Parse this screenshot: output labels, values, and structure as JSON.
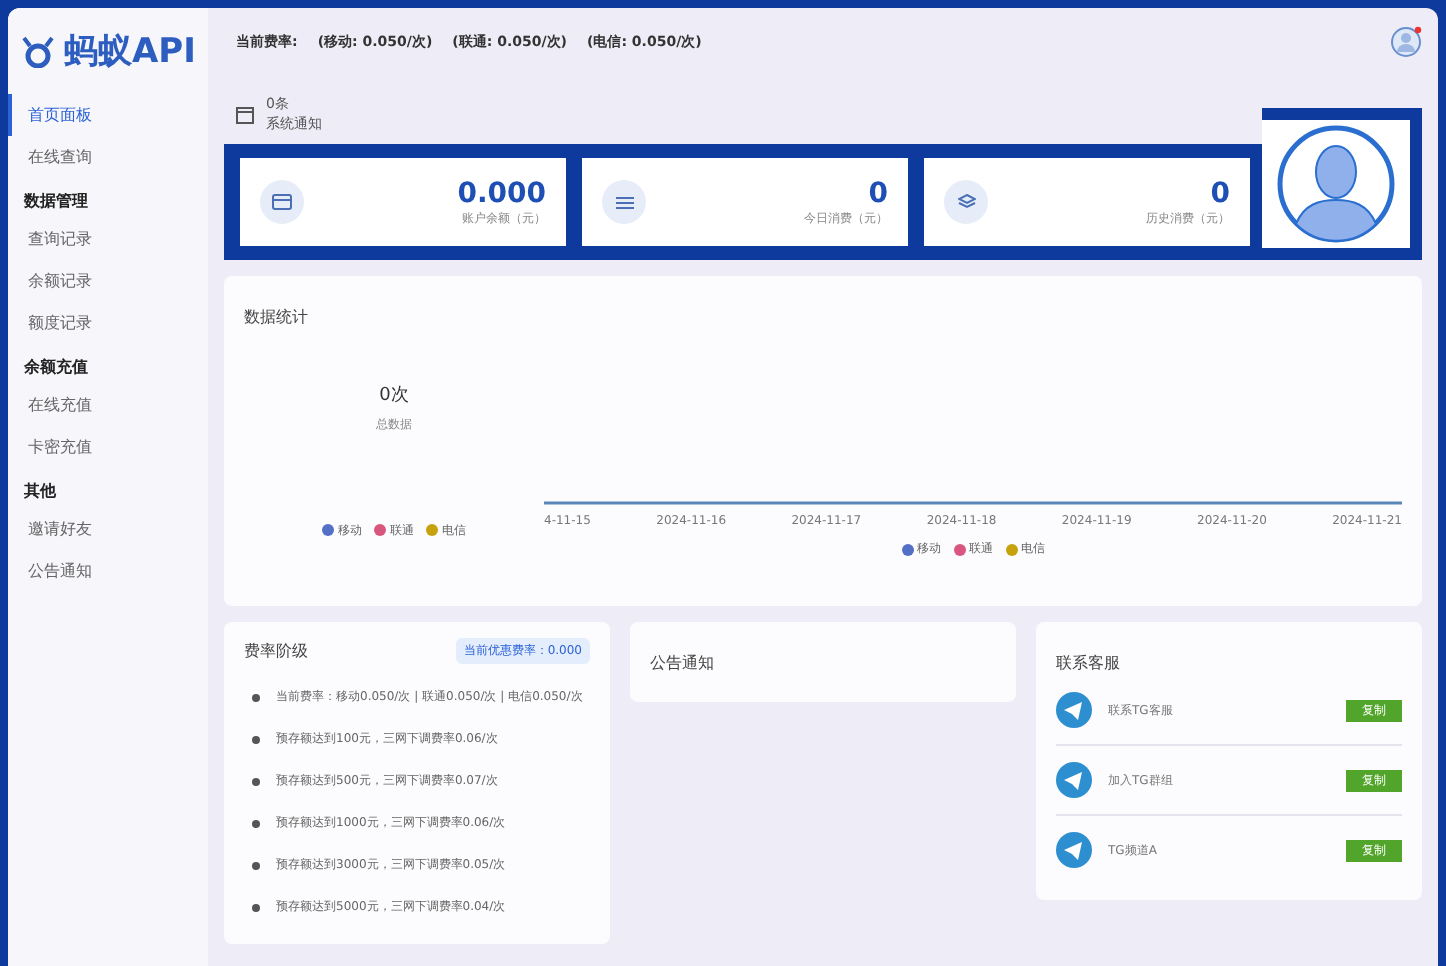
{
  "brand": {
    "name": "蚂蚁API"
  },
  "rate_bar": {
    "label": "当前费率:",
    "items": [
      "(移动: 0.050/次)",
      "(联通: 0.050/次)",
      "(电信: 0.050/次)"
    ]
  },
  "sidebar": {
    "items": [
      {
        "kind": "link",
        "label": "首页面板",
        "selected": true
      },
      {
        "kind": "link",
        "label": "在线查询",
        "selected": false
      },
      {
        "kind": "section",
        "label": "数据管理"
      },
      {
        "kind": "link",
        "label": "查询记录",
        "selected": false
      },
      {
        "kind": "link",
        "label": "余额记录",
        "selected": false
      },
      {
        "kind": "link",
        "label": "额度记录",
        "selected": false
      },
      {
        "kind": "section",
        "label": "余额充值"
      },
      {
        "kind": "link",
        "label": "在线充值",
        "selected": false
      },
      {
        "kind": "link",
        "label": "卡密充值",
        "selected": false
      },
      {
        "kind": "section",
        "label": "其他"
      },
      {
        "kind": "link",
        "label": "邀请好友",
        "selected": false
      },
      {
        "kind": "link",
        "label": "公告通知",
        "selected": false
      }
    ]
  },
  "notice": {
    "count": "0条",
    "label": "系统通知"
  },
  "stats": [
    {
      "kind": "card",
      "value": "0.000",
      "label": "账户余额（元）"
    },
    {
      "kind": "list",
      "value": "0",
      "label": "今日消费（元）"
    },
    {
      "kind": "layers",
      "value": "0",
      "label": "历史消费（元）"
    }
  ],
  "chart_panel": {
    "title": "数据统计",
    "total": "0次",
    "total_label": "总数据",
    "legend": [
      {
        "label": "移动",
        "color": "#5470c6"
      },
      {
        "label": "联通",
        "color": "#d9577f"
      },
      {
        "label": "电信",
        "color": "#c8a20c"
      }
    ],
    "x_labels": [
      "4-11-15",
      "2024-11-16",
      "2024-11-17",
      "2024-11-18",
      "2024-11-19",
      "2024-11-20",
      "2024-11-21"
    ],
    "chart_legend": [
      {
        "label": "移动",
        "color": "#5470c6"
      },
      {
        "label": "联通",
        "color": "#d9577f"
      },
      {
        "label": "电信",
        "color": "#c8a20c"
      }
    ]
  },
  "fee_panel": {
    "title": "费率阶级",
    "badge": "当前优惠费率：0.000",
    "items": [
      "当前费率：移动0.050/次 | 联通0.050/次 | 电信0.050/次",
      "预存额达到100元，三网下调费率0.06/次",
      "预存额达到500元，三网下调费率0.07/次",
      "预存额达到1000元，三网下调费率0.06/次",
      "预存额达到3000元，三网下调费率0.05/次",
      "预存额达到5000元，三网下调费率0.04/次"
    ]
  },
  "announcement_panel": {
    "title": "公告通知"
  },
  "contact_panel": {
    "title": "联系客服",
    "items": [
      {
        "label": "联系TG客服",
        "button": "复制"
      },
      {
        "label": "加入TG群组",
        "button": "复制"
      },
      {
        "label": "TG频道A",
        "button": "复制"
      }
    ]
  }
}
